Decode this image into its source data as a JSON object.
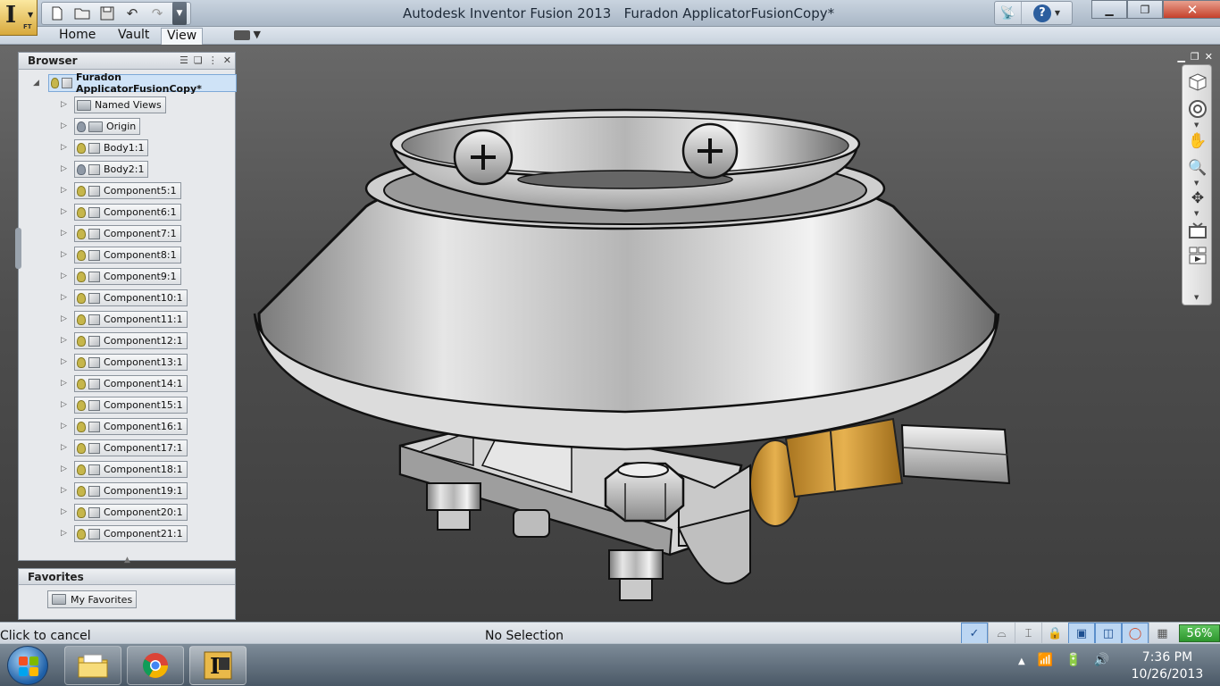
{
  "app": {
    "title": "Autodesk Inventor Fusion 2013",
    "document": "Furadon ApplicatorFusionCopy*",
    "logo_letter": "I",
    "logo_sub": "FT"
  },
  "quick_access": {
    "icons": [
      "new-file-icon",
      "open-folder-icon",
      "save-icon",
      "undo-icon",
      "redo-icon",
      "qat-dropdown-icon"
    ]
  },
  "ribbon": {
    "tabs": [
      {
        "label": "Home"
      },
      {
        "label": "Vault"
      },
      {
        "label": "View",
        "active": true
      }
    ]
  },
  "browser": {
    "title": "Browser",
    "root": "Furadon ApplicatorFusionCopy*",
    "items": [
      {
        "label": "Named Views",
        "icon": "folder-icon"
      },
      {
        "label": "Origin",
        "icon": "folder-icon",
        "visibility": "off"
      },
      {
        "label": "Body1:1",
        "icon": "cube-icon",
        "visibility": "on"
      },
      {
        "label": "Body2:1",
        "icon": "cube-icon",
        "visibility": "off"
      },
      {
        "label": "Component5:1",
        "icon": "cube-icon",
        "visibility": "on"
      },
      {
        "label": "Component6:1",
        "icon": "cube-icon",
        "visibility": "on"
      },
      {
        "label": "Component7:1",
        "icon": "cube-icon",
        "visibility": "on"
      },
      {
        "label": "Component8:1",
        "icon": "cube-icon",
        "visibility": "on"
      },
      {
        "label": "Component9:1",
        "icon": "cube-icon",
        "visibility": "on"
      },
      {
        "label": "Component10:1",
        "icon": "cube-icon",
        "visibility": "on"
      },
      {
        "label": "Component11:1",
        "icon": "cube-icon",
        "visibility": "on"
      },
      {
        "label": "Component12:1",
        "icon": "cube-icon",
        "visibility": "on"
      },
      {
        "label": "Component13:1",
        "icon": "cube-icon",
        "visibility": "on"
      },
      {
        "label": "Component14:1",
        "icon": "cube-icon",
        "visibility": "on"
      },
      {
        "label": "Component15:1",
        "icon": "cube-icon",
        "visibility": "on"
      },
      {
        "label": "Component16:1",
        "icon": "cube-icon",
        "visibility": "on"
      },
      {
        "label": "Component17:1",
        "icon": "cube-icon",
        "visibility": "on"
      },
      {
        "label": "Component18:1",
        "icon": "cube-icon",
        "visibility": "on"
      },
      {
        "label": "Component19:1",
        "icon": "cube-icon",
        "visibility": "on"
      },
      {
        "label": "Component20:1",
        "icon": "cube-icon",
        "visibility": "on"
      },
      {
        "label": "Component21:1",
        "icon": "cube-icon",
        "visibility": "on"
      }
    ]
  },
  "favorites": {
    "title": "Favorites",
    "items": [
      {
        "label": "My Favorites",
        "icon": "favorites-folder-icon"
      }
    ]
  },
  "status": {
    "left": "Click to cancel",
    "center": "No Selection",
    "zoom": "56%",
    "icons": [
      "checkmark-icon",
      "hat-icon",
      "bracket-icon",
      "lock-icon",
      "frame-icon",
      "eraser-icon",
      "ring-icon",
      "grid-icon"
    ]
  },
  "taskbar": {
    "apps": [
      "file-explorer-icon",
      "chrome-icon",
      "inventor-fusion-icon"
    ],
    "time": "7:36 PM",
    "date": "10/26/2013"
  },
  "colors": {
    "browser_selection": "#cfe3f7",
    "zoom_badge": "#2d962d",
    "fitting_gold": "#d9a13a"
  }
}
